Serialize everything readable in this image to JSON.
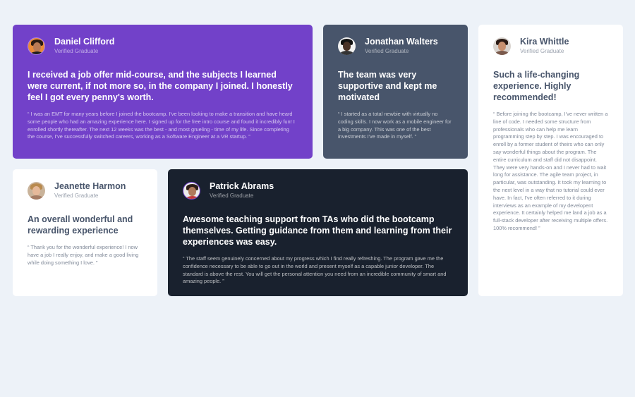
{
  "testimonials": [
    {
      "name": "Daniel Clifford",
      "status": "Verified Graduate",
      "headline": "I received a job offer mid-course, and the subjects I learned were current, if not more so, in the company I joined. I honestly feel I got every penny's worth.",
      "quote": "“ I was an EMT for many years before I joined the bootcamp. I've been looking to make a transition and have heard some people who had an amazing experience here. I signed up for the free intro course and found it incredibly fun! I enrolled shortly thereafter. The next 12 weeks was the best - and most grueling - time of my life. Since completing the course, I've successfully switched careers, working as a Software Engineer at a VR startup. ”",
      "avatar": "avatar-daniel"
    },
    {
      "name": "Jonathan Walters",
      "status": "Verified Graduate",
      "headline": "The team was very supportive and kept me motivated",
      "quote": "“ I started as a total newbie with virtually no coding skills. I now work as a mobile engineer for a big company. This was one of the best investments I've made in myself. ”",
      "avatar": "avatar-jonathan"
    },
    {
      "name": "Kira Whittle",
      "status": "Verified Graduate",
      "headline": "Such a life-changing experience. Highly recommended!",
      "quote": "“ Before joining the bootcamp, I've never written a line of code. I needed some structure from professionals who can help me learn programming step by step. I was encouraged to enroll by a former student of theirs who can only say wonderful things about the program. The entire curriculum and staff did not disappoint. They were very hands-on and I never had to wait long for assistance. The agile team project, in particular, was outstanding. It took my learning to the next level in a way that no tutorial could ever have. In fact, I've often referred to it during interviews as an example of my developent experience. It certainly helped me land a job as a full-stack developer after receiving multiple offers. 100% recommend! ”",
      "avatar": "avatar-kira"
    },
    {
      "name": "Jeanette Harmon",
      "status": "Verified Graduate",
      "headline": "An overall wonderful and rewarding experience",
      "quote": "“ Thank you for the wonderful experience! I now have a job I really enjoy, and make a good living while doing something I love. ”",
      "avatar": "avatar-jeanette"
    },
    {
      "name": "Patrick Abrams",
      "status": "Verified Graduate",
      "headline": "Awesome teaching support from TAs who did the bootcamp themselves. Getting guidance from them and learning from their experiences was easy.",
      "quote": "“ The staff seem genuinely concerned about my progress which I find really refreshing. The program gave me the confidence necessary to be able to go out in the world and present myself as a capable junior developer. The standard is above the rest. You will get the personal attention you need from an incredible community of smart and amazing people. ”",
      "avatar": "avatar-patrick"
    }
  ],
  "colors": {
    "page_bg": "#edf2f8",
    "violet": "#7241c9",
    "grayish_blue": "#48556b",
    "blackish_blue": "#19212e",
    "white": "#ffffff"
  }
}
